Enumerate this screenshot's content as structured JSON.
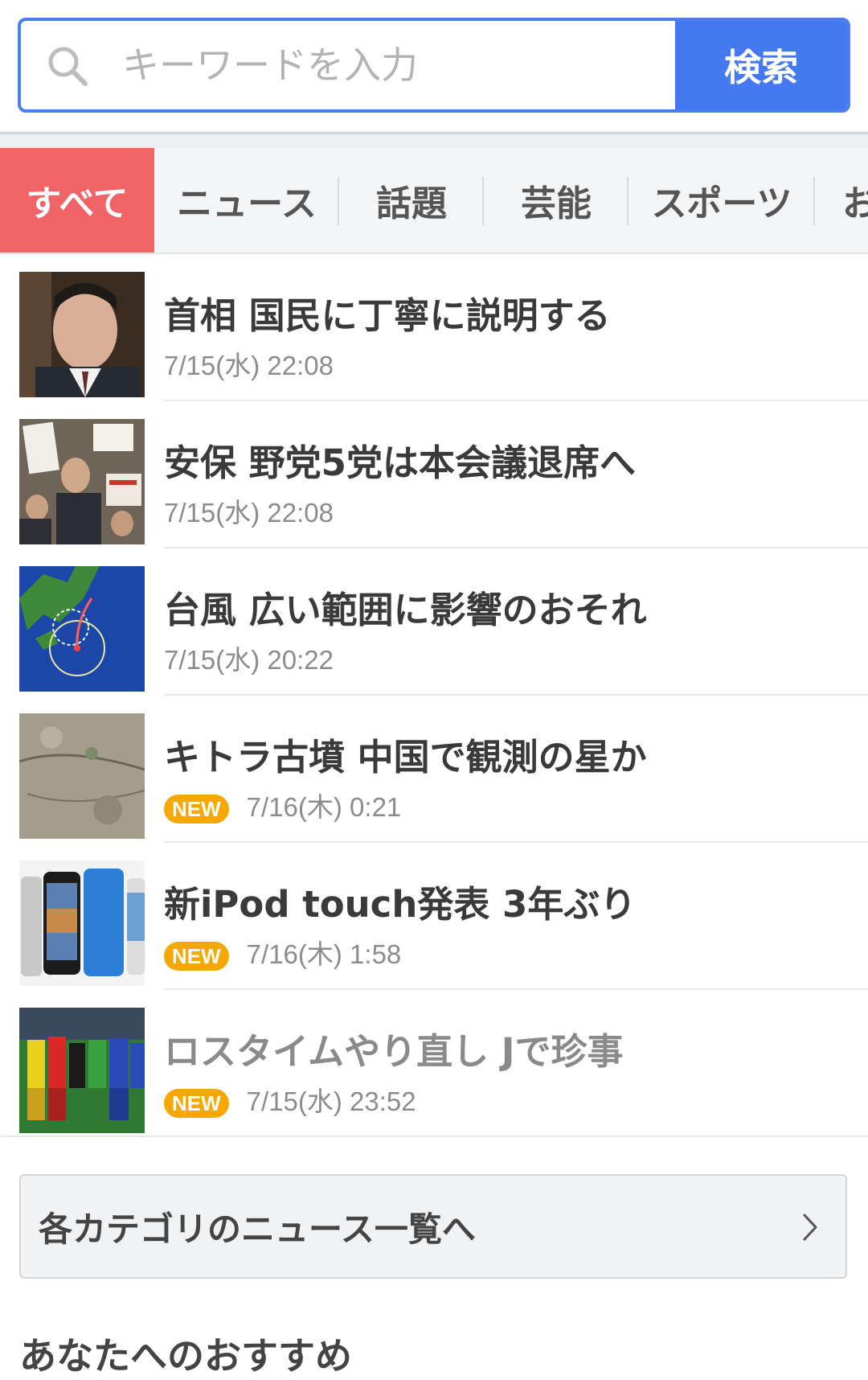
{
  "search": {
    "placeholder": "キーワードを入力",
    "value": "",
    "button_label": "検索",
    "accent_color": "#4479f2"
  },
  "tabs": [
    {
      "label": "すべて",
      "active": true
    },
    {
      "label": "ニュース",
      "active": false
    },
    {
      "label": "話題",
      "active": false
    },
    {
      "label": "芸能",
      "active": false
    },
    {
      "label": "スポーツ",
      "active": false
    },
    {
      "label": "お",
      "active": false
    }
  ],
  "news": [
    {
      "title": "首相 国民に丁寧に説明する",
      "date": "7/15(水) 22:08",
      "is_new": false,
      "read": false,
      "thumb": "person-portrait"
    },
    {
      "title": "安保 野党5党は本会議退席へ",
      "date": "7/15(水) 22:08",
      "is_new": false,
      "read": false,
      "thumb": "protest-crowd"
    },
    {
      "title": "台風 広い範囲に影響のおそれ",
      "date": "7/15(水) 20:22",
      "is_new": false,
      "read": false,
      "thumb": "typhoon-map"
    },
    {
      "title": "キトラ古墳 中国で観測の星か",
      "date": "7/16(木) 0:21",
      "is_new": true,
      "read": false,
      "thumb": "stone-wall"
    },
    {
      "title": "新iPod touch発表 3年ぶり",
      "date": "7/16(木) 1:58",
      "is_new": true,
      "read": false,
      "thumb": "ipod-devices"
    },
    {
      "title": "ロスタイムやり直し Jで珍事",
      "date": "7/15(水) 23:52",
      "is_new": true,
      "read": true,
      "thumb": "soccer-players"
    }
  ],
  "new_badge_label": "NEW",
  "category_link": {
    "label": "各カテゴリのニュース一覧へ"
  },
  "recommend": {
    "heading": "あなたへのおすすめ"
  }
}
